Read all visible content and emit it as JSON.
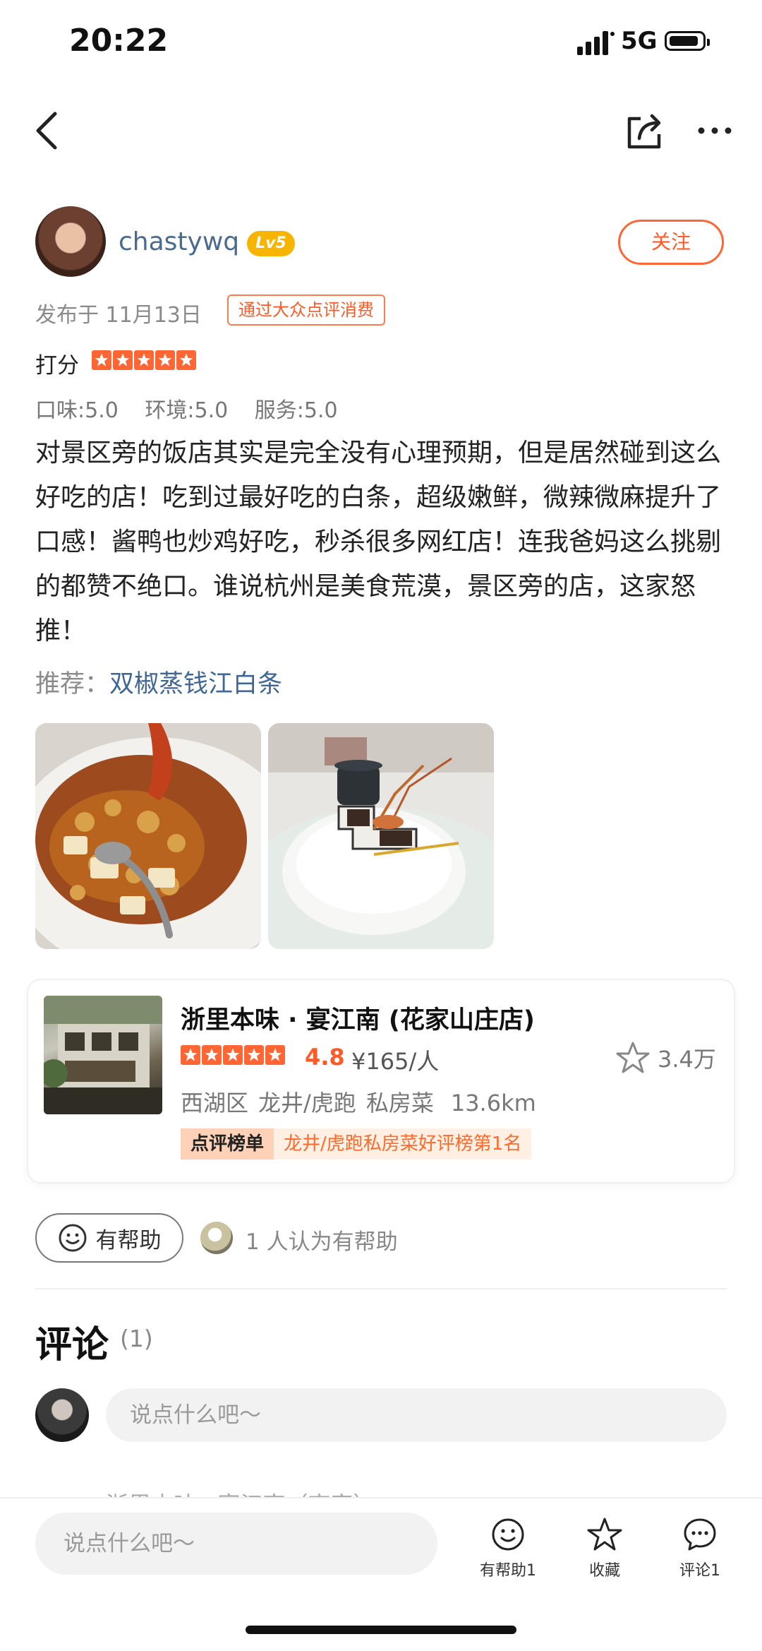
{
  "status_bar": {
    "time": "20:22",
    "network": "5G"
  },
  "user": {
    "name": "chastywq",
    "level": "Lv5",
    "follow_label": "关注"
  },
  "meta": {
    "published": "发布于 11月13日",
    "verified_tag": "通过大众点评消费"
  },
  "rating": {
    "label": "打分",
    "stars": 5,
    "subscores": [
      "口味:5.0",
      "环境:5.0",
      "服务:5.0"
    ]
  },
  "review": {
    "text": "对景区旁的饭店其实是完全没有心理预期，但是居然碰到这么好吃的店！吃到过最好吃的白条，超级嫩鲜，微辣微麻提升了口感！酱鸭也炒鸡好吃，秒杀很多网红店！连我爸妈这么挑剔的都赞不绝口。谁说杭州是美食荒漠，景区旁的店，这家怒推！",
    "recommend_label": "推荐：",
    "recommend_dish": "双椒蒸钱江白条"
  },
  "shop": {
    "name": "浙里本味 · 宴江南 (花家山庄店)",
    "stars": 5,
    "score": "4.8",
    "price": "¥165/人",
    "favorites": "3.4万",
    "district": "西湖区",
    "area": "龙井/虎跑",
    "cuisine": "私房菜",
    "distance": "13.6km",
    "rank_tag": "点评榜单",
    "rank_text": "龙井/虎跑私房菜好评榜第1名"
  },
  "helpful": {
    "button_label": "有帮助",
    "count_text": "1 人认为有帮助"
  },
  "comments": {
    "title": "评论",
    "count": "(1)",
    "input_placeholder": "说点什么吧～",
    "peek_text": "浙里本味 · 宴江南（商家）"
  },
  "bottom_bar": {
    "input_placeholder": "说点什么吧～",
    "helpful_label": "有帮助1",
    "favorite_label": "收藏",
    "comment_label": "评论1"
  },
  "colors": {
    "accent": "#ff5a26",
    "link": "#3f6694",
    "level_badge": "#f7b400"
  },
  "icons": [
    "back-icon",
    "share-icon",
    "more-icon",
    "smile-icon",
    "star-outline-icon",
    "comment-icon"
  ]
}
